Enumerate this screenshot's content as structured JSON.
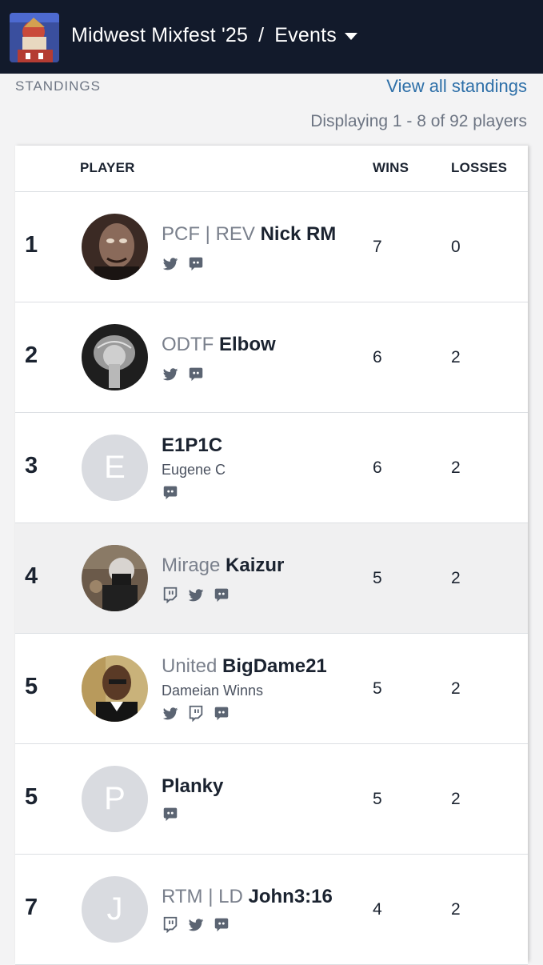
{
  "header": {
    "tournament": "Midwest Mixfest '25",
    "separator": "/",
    "section": "Events"
  },
  "standings": {
    "title": "STANDINGS",
    "view_all": "View all standings",
    "displaying": "Displaying 1 - 8 of 92 players",
    "columns": {
      "player": "PLAYER",
      "wins": "WINS",
      "losses": "LOSSES"
    },
    "rows": [
      {
        "rank": "1",
        "prefix": "PCF | REV",
        "tag": "Nick RM",
        "name": "",
        "avatar_letter": "",
        "wins": "7",
        "losses": "0",
        "icons": [
          "twitter-icon",
          "discord-icon"
        ]
      },
      {
        "rank": "2",
        "prefix": "ODTF",
        "tag": "Elbow",
        "name": "",
        "avatar_letter": "",
        "wins": "6",
        "losses": "2",
        "icons": [
          "twitter-icon",
          "discord-icon"
        ]
      },
      {
        "rank": "3",
        "prefix": "",
        "tag": "E1P1C",
        "name": "Eugene C",
        "avatar_letter": "E",
        "wins": "6",
        "losses": "2",
        "icons": [
          "discord-icon"
        ]
      },
      {
        "rank": "4",
        "prefix": "Mirage",
        "tag": "Kaizur",
        "name": "",
        "avatar_letter": "",
        "wins": "5",
        "losses": "2",
        "icons": [
          "twitch-icon",
          "twitter-icon",
          "discord-icon"
        ]
      },
      {
        "rank": "5",
        "prefix": "United",
        "tag": "BigDame21",
        "name": "Dameian Winns",
        "avatar_letter": "",
        "wins": "5",
        "losses": "2",
        "icons": [
          "twitter-icon",
          "twitch-icon",
          "discord-icon"
        ]
      },
      {
        "rank": "5",
        "prefix": "",
        "tag": "Planky",
        "name": "",
        "avatar_letter": "P",
        "wins": "5",
        "losses": "2",
        "icons": [
          "discord-icon"
        ]
      },
      {
        "rank": "7",
        "prefix": "RTM | LD",
        "tag": "John3:16",
        "name": "",
        "avatar_letter": "J",
        "wins": "4",
        "losses": "2",
        "icons": [
          "twitch-icon",
          "twitter-icon",
          "discord-icon"
        ]
      }
    ]
  },
  "colors": {
    "topbar": "#121a2b",
    "link": "#2d6fa8",
    "icon": "#5b6472"
  }
}
